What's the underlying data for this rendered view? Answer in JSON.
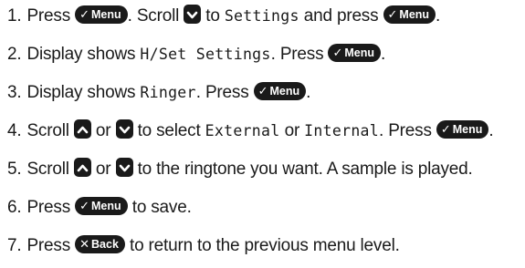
{
  "steps": [
    {
      "number": "1.",
      "parts": [
        {
          "t": "text",
          "v": "Press "
        },
        {
          "t": "key",
          "icon": "check-icon",
          "glyph": "✓",
          "v": "Menu"
        },
        {
          "t": "text",
          "v": ". Scroll "
        },
        {
          "t": "arrow",
          "icon": "scroll-down-icon",
          "dir": "down"
        },
        {
          "t": "text",
          "v": " to "
        },
        {
          "t": "lcd",
          "v": "Settings"
        },
        {
          "t": "text",
          "v": " and press "
        },
        {
          "t": "key",
          "icon": "check-icon",
          "glyph": "✓",
          "v": "Menu"
        },
        {
          "t": "text",
          "v": "."
        }
      ]
    },
    {
      "number": "2.",
      "parts": [
        {
          "t": "text",
          "v": "Display shows "
        },
        {
          "t": "lcd",
          "v": "H/Set Settings"
        },
        {
          "t": "text",
          "v": ". Press "
        },
        {
          "t": "key",
          "icon": "check-icon",
          "glyph": "✓",
          "v": "Menu"
        },
        {
          "t": "text",
          "v": "."
        }
      ]
    },
    {
      "number": "3.",
      "parts": [
        {
          "t": "text",
          "v": "Display shows "
        },
        {
          "t": "lcd",
          "v": "Ringer"
        },
        {
          "t": "text",
          "v": ". Press "
        },
        {
          "t": "key",
          "icon": "check-icon",
          "glyph": "✓",
          "v": "Menu"
        },
        {
          "t": "text",
          "v": "."
        }
      ]
    },
    {
      "number": "4.",
      "parts": [
        {
          "t": "text",
          "v": "Scroll "
        },
        {
          "t": "arrow",
          "icon": "scroll-up-icon",
          "dir": "up"
        },
        {
          "t": "text",
          "v": " or "
        },
        {
          "t": "arrow",
          "icon": "scroll-down-icon",
          "dir": "down"
        },
        {
          "t": "text",
          "v": " to select "
        },
        {
          "t": "lcd",
          "v": "External"
        },
        {
          "t": "text",
          "v": " or "
        },
        {
          "t": "lcd",
          "v": "Internal"
        },
        {
          "t": "text",
          "v": ". Press "
        },
        {
          "t": "key",
          "icon": "check-icon",
          "glyph": "✓",
          "v": "Menu"
        },
        {
          "t": "text",
          "v": "."
        }
      ]
    },
    {
      "number": "5.",
      "parts": [
        {
          "t": "text",
          "v": "Scroll "
        },
        {
          "t": "arrow",
          "icon": "scroll-up-icon",
          "dir": "up"
        },
        {
          "t": "text",
          "v": " or "
        },
        {
          "t": "arrow",
          "icon": "scroll-down-icon",
          "dir": "down"
        },
        {
          "t": "text",
          "v": " to the ringtone you want. A sample is played."
        }
      ]
    },
    {
      "number": "6.",
      "parts": [
        {
          "t": "text",
          "v": "Press "
        },
        {
          "t": "key",
          "icon": "check-icon",
          "glyph": "✓",
          "v": "Menu"
        },
        {
          "t": "text",
          "v": " to save."
        }
      ]
    },
    {
      "number": "7.",
      "parts": [
        {
          "t": "text",
          "v": "Press "
        },
        {
          "t": "key",
          "icon": "close-icon",
          "glyph": "✕",
          "v": "Back"
        },
        {
          "t": "text",
          "v": " to return to the previous menu level."
        }
      ]
    }
  ]
}
